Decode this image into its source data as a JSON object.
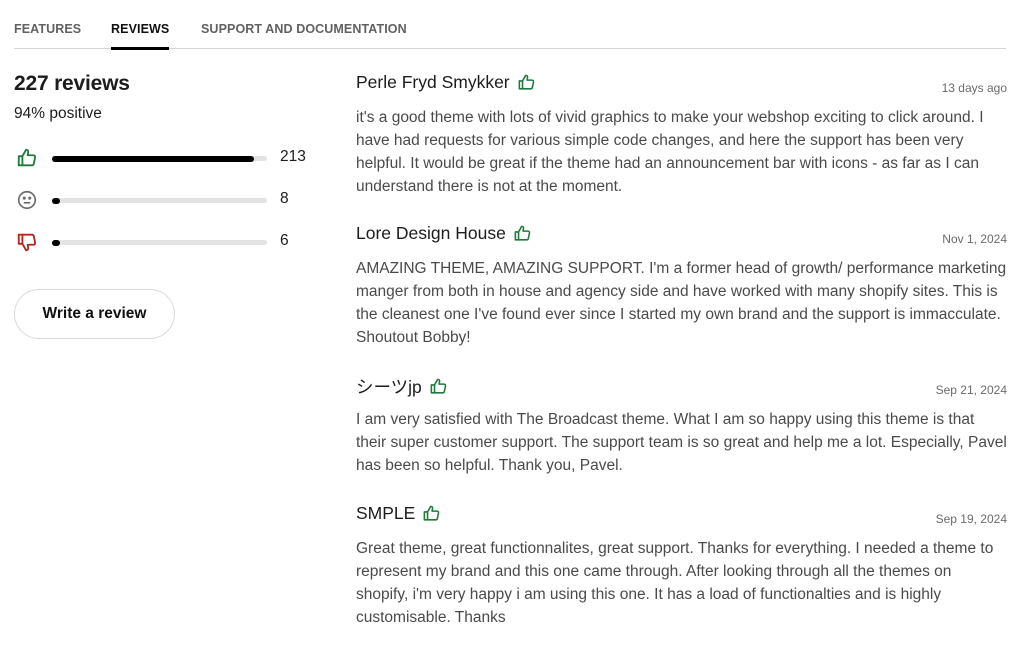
{
  "tabs": [
    {
      "label": "FEATURES",
      "active": false
    },
    {
      "label": "REVIEWS",
      "active": true
    },
    {
      "label": "SUPPORT AND DOCUMENTATION",
      "active": false
    }
  ],
  "summary": {
    "title": "227 reviews",
    "positive": "94% positive",
    "ratings": [
      {
        "type": "positive",
        "icon": "thumbs-up-icon",
        "count": "213",
        "fraction": 0.94,
        "color": "#1f7a3d"
      },
      {
        "type": "neutral",
        "icon": "neutral-face-icon",
        "count": "8",
        "fraction": 0.035,
        "color": "#6b6b6b"
      },
      {
        "type": "negative",
        "icon": "thumbs-down-icon",
        "count": "6",
        "fraction": 0.026,
        "color": "#b3261e"
      }
    ],
    "write_review_label": "Write a review"
  },
  "reviews": [
    {
      "name": "Perle Fryd Smykker",
      "sentiment_icon": "thumbs-up-icon",
      "date": "13 days ago",
      "body": "it's a good theme with lots of vivid graphics to make your webshop exciting to click around. I have had requests for various simple code changes, and here the support has been very helpful. It would be great if the theme had an announcement bar with icons - as far as I can understand there is not at the moment."
    },
    {
      "name": "Lore Design House",
      "sentiment_icon": "thumbs-up-icon",
      "date": "Nov 1, 2024",
      "body": "AMAZING THEME, AMAZING SUPPORT. I'm a former head of growth/ performance marketing manger from both in house and agency side and have worked with many shopify sites. This is the cleanest one I've found ever since I started my own brand and the support is immacculate. Shoutout Bobby!"
    },
    {
      "name": "シーツjp",
      "sentiment_icon": "thumbs-up-icon",
      "date": "Sep 21, 2024",
      "body": "I am very satisfied with The Broadcast theme. What I am so happy using this theme is that their super customer support. The support team is so great and help me a lot. Especially, Pavel has been so helpful. Thank you, Pavel."
    },
    {
      "name": "SMPLE",
      "sentiment_icon": "thumbs-up-icon",
      "date": "Sep 19, 2024",
      "body": "Great theme, great functionnalites, great support. Thanks for everything. I needed a theme to represent my brand and this one came through. After looking through all the themes on shopify, i'm very happy i am using this one. It has a load of functionalties and is highly customisable. Thanks"
    }
  ],
  "colors": {
    "positive": "#1f7a3d",
    "neutral": "#6b6b6b",
    "negative": "#b3261e",
    "active_tab_underline": "#000000"
  }
}
